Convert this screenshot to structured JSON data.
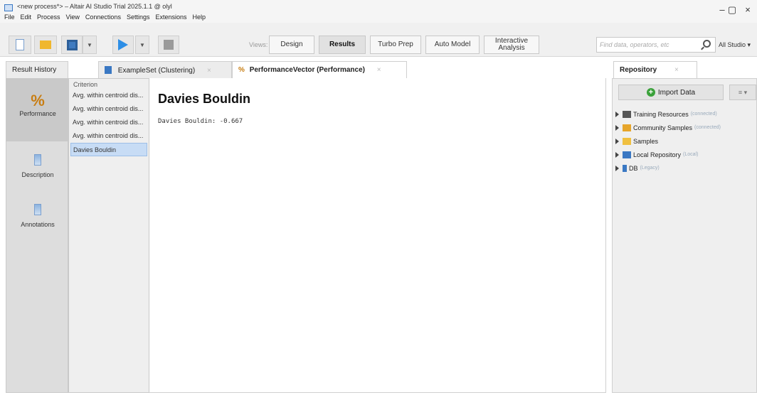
{
  "window": {
    "title": "<new process*> – Altair AI Studio Trial 2025.1.1 @ olyl",
    "controls": {
      "minimize": "–",
      "maximize": "▢",
      "close": "×"
    }
  },
  "menu": [
    "File",
    "Edit",
    "Process",
    "View",
    "Connections",
    "Settings",
    "Extensions",
    "Help"
  ],
  "toolbar": {
    "views_label": "Views:",
    "views": [
      {
        "label": "Design",
        "active": false
      },
      {
        "label": "Results",
        "active": true
      },
      {
        "label": "Turbo Prep",
        "active": false
      },
      {
        "label": "Auto Model",
        "active": false
      },
      {
        "label": "Interactive Analysis",
        "active": false
      }
    ],
    "search_placeholder": "Find data, operators, etc",
    "studio_label": "All Studio ▾"
  },
  "tabs": {
    "result_history": "Result History",
    "exampleset": "ExampleSet (Clustering)",
    "performance": "PerformanceVector (Performance)",
    "close": "×"
  },
  "sidebar": {
    "performance": "Performance",
    "performance_icon": "%",
    "description": "Description",
    "annotations": "Annotations"
  },
  "criterion": {
    "header": "Criterion",
    "items": [
      "Avg. within centroid dis...",
      "Avg. within centroid dis...",
      "Avg. within centroid dis...",
      "Avg. within centroid dis...",
      "Davies Bouldin"
    ],
    "selected_index": 4
  },
  "main": {
    "heading": "Davies Bouldin",
    "result_line": "Davies Bouldin: -0.667"
  },
  "repository": {
    "tab_label": "Repository",
    "import_label": "Import Data",
    "menu_label": "≡ ▾",
    "items": [
      {
        "label": "Training Resources",
        "tag": "(connected)",
        "color": "#555555"
      },
      {
        "label": "Community Samples",
        "tag": "(connected)",
        "color": "#e6a52a"
      },
      {
        "label": "Samples",
        "tag": "",
        "color": "#f0c040"
      },
      {
        "label": "Local Repository",
        "tag": "(Local)",
        "color": "#3a78c3"
      },
      {
        "label": "DB",
        "tag": "(Legacy)",
        "color": "#3a78c3"
      }
    ]
  }
}
